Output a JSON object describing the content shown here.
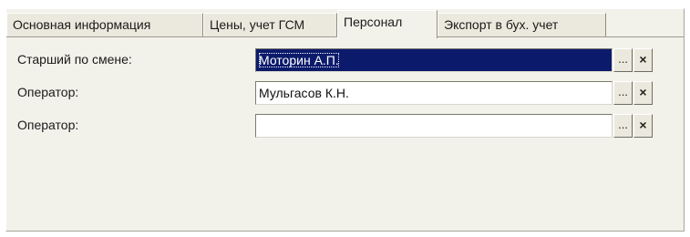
{
  "tabs": [
    {
      "label": "Основная информация",
      "active": false
    },
    {
      "label": "Цены, учет ГСМ",
      "active": false
    },
    {
      "label": "Персонал",
      "active": true
    },
    {
      "label": "Экспорт в бух. учет",
      "active": false
    }
  ],
  "fields": [
    {
      "label": "Старший по смене:",
      "value": "Моторин А.П.",
      "selected": true
    },
    {
      "label": "Оператор:",
      "value": "Мульгасов К.Н.",
      "selected": false
    },
    {
      "label": "Оператор:",
      "value": "",
      "selected": false
    }
  ],
  "buttons": {
    "select_glyph": "...",
    "clear_glyph": "×"
  },
  "colors": {
    "selection_background": "#0b1a6b",
    "panel_background": "#f2f1ea"
  }
}
